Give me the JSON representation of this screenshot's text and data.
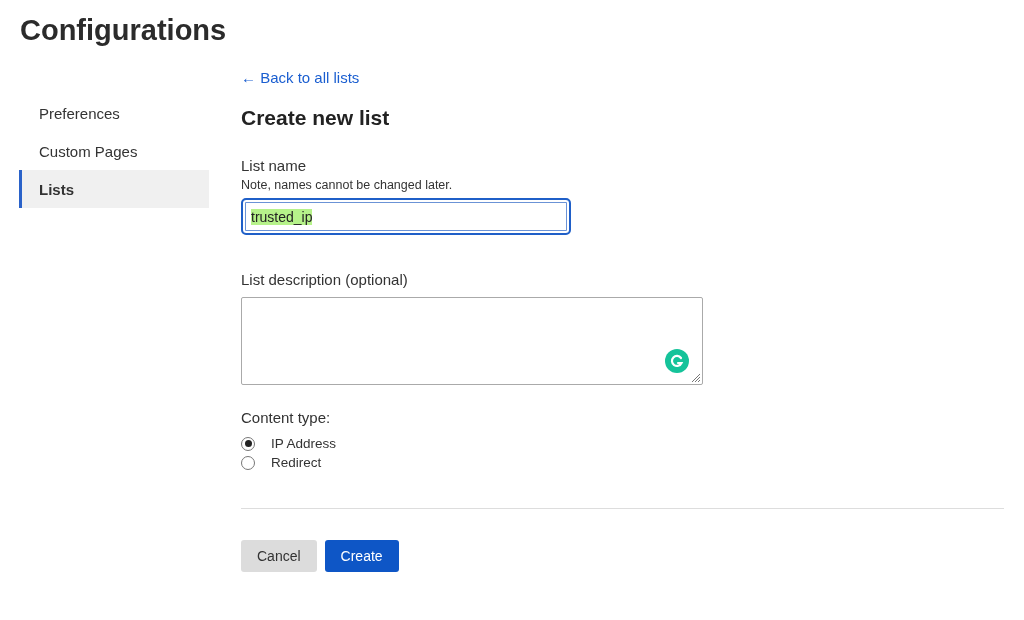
{
  "page": {
    "title": "Configurations"
  },
  "sidebar": {
    "items": [
      {
        "label": "Preferences",
        "selected": false
      },
      {
        "label": "Custom Pages",
        "selected": false
      },
      {
        "label": "Lists",
        "selected": true
      }
    ]
  },
  "back_link": "← Back to all lists",
  "heading": "Create new list",
  "name_field": {
    "label": "List name",
    "hint": "Note, names cannot be changed later.",
    "value": "trusted_ip",
    "focused": true,
    "text_selected": true
  },
  "description_field": {
    "label": "List description (optional)"
  },
  "content_type": {
    "label": "Content type:",
    "options": [
      {
        "label": "IP Address",
        "selected": true
      },
      {
        "label": "Redirect",
        "selected": false
      }
    ]
  },
  "buttons": [
    {
      "label": "Cancel",
      "kind": "secondary"
    },
    {
      "label": "Create",
      "kind": "primary"
    }
  ]
}
